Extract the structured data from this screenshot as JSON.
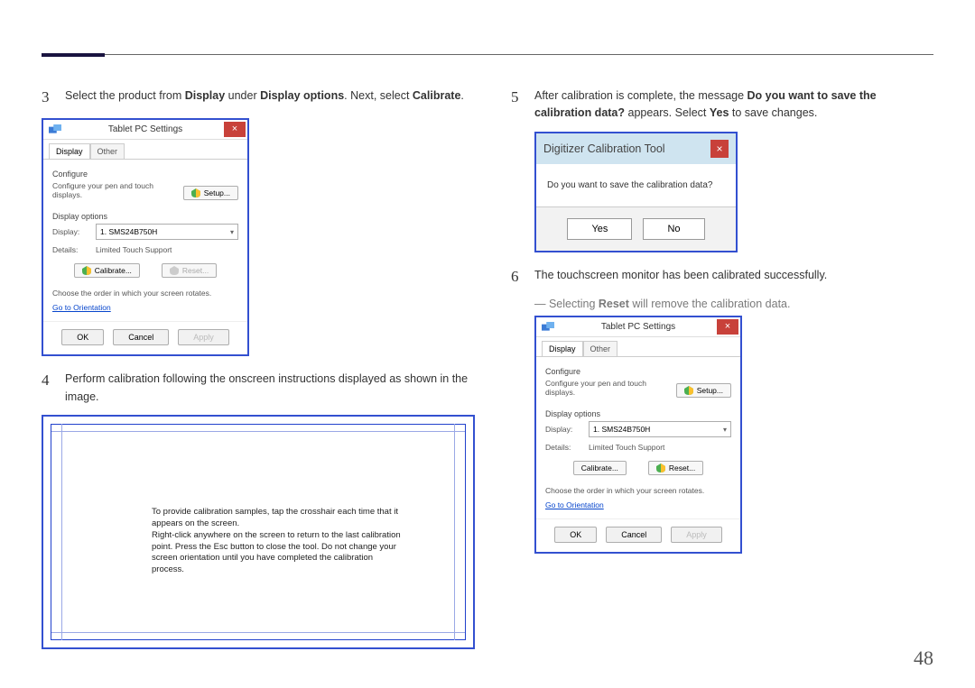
{
  "page_number": "48",
  "steps": {
    "s3": {
      "num": "3",
      "pre": "Select the product from ",
      "b1": "Display",
      "mid1": " under ",
      "b2": "Display options",
      "mid2": ". Next, select ",
      "b3": "Calibrate",
      "post": "."
    },
    "s4": {
      "num": "4",
      "text": "Perform calibration following the onscreen instructions displayed as shown in the image."
    },
    "s5": {
      "num": "5",
      "pre": "After calibration is complete, the message ",
      "b1": "Do you want to save the calibration data?",
      "mid": " appears. Select ",
      "b2": "Yes",
      "post": " to save changes."
    },
    "s6": {
      "num": "6",
      "text": "The touchscreen monitor has been calibrated successfully."
    }
  },
  "note": {
    "pre": "― Selecting ",
    "b": "Reset",
    "post": " will remove the calibration data."
  },
  "tablet_window": {
    "title": "Tablet PC Settings",
    "close": "×",
    "tabs": {
      "display": "Display",
      "other": "Other"
    },
    "configure_label": "Configure",
    "configure_sub": "Configure your pen and touch displays.",
    "setup_btn": "Setup...",
    "display_options_label": "Display options",
    "display_label": "Display:",
    "display_value": "1. SMS24B750H",
    "details_label": "Details:",
    "details_value": "Limited Touch Support",
    "calibrate_btn": "Calibrate...",
    "calibrate_btn_plain": "Calibrate...",
    "reset_btn": "Reset...",
    "rotate_label": "Choose the order in which your screen rotates.",
    "orientation_link": "Go to Orientation",
    "ok": "OK",
    "cancel": "Cancel",
    "apply": "Apply"
  },
  "calib_screen": {
    "line1": "To provide calibration samples, tap the crosshair each time that it appears on the screen.",
    "line2": "Right-click anywhere on the screen to return to the last calibration point. Press the Esc button to close the tool. Do not change your screen orientation until you have completed the calibration process."
  },
  "digitizer": {
    "title": "Digitizer Calibration Tool",
    "close": "×",
    "body": "Do you want to save the calibration data?",
    "yes": "Yes",
    "no": "No"
  }
}
